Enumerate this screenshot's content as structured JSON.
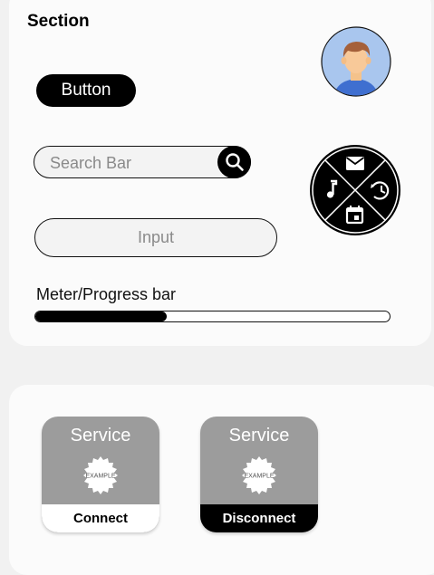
{
  "section": {
    "title": "Section",
    "button_label": "Button",
    "search": {
      "placeholder": "Search Bar",
      "icon": "search-icon"
    },
    "input": {
      "label": "Input"
    },
    "meter": {
      "label": "Meter/Progress bar",
      "progress": 0.37
    },
    "avatar": {
      "icon": "user-avatar"
    },
    "radial_menu": {
      "items": [
        "mail-icon",
        "clock-icon",
        "calendar-icon",
        "music-icon"
      ]
    }
  },
  "services": [
    {
      "title": "Service",
      "badge": "EXAMPLE",
      "action": "Connect"
    },
    {
      "title": "Service",
      "badge": "EXAMPLE",
      "action": "Disconnect"
    }
  ],
  "colors": {
    "background": "#f1f1f1",
    "card": "#fbfbfb",
    "primary": "#000000",
    "service_card": "#9c9c9c",
    "avatar_circle": "#a8c8f0"
  }
}
